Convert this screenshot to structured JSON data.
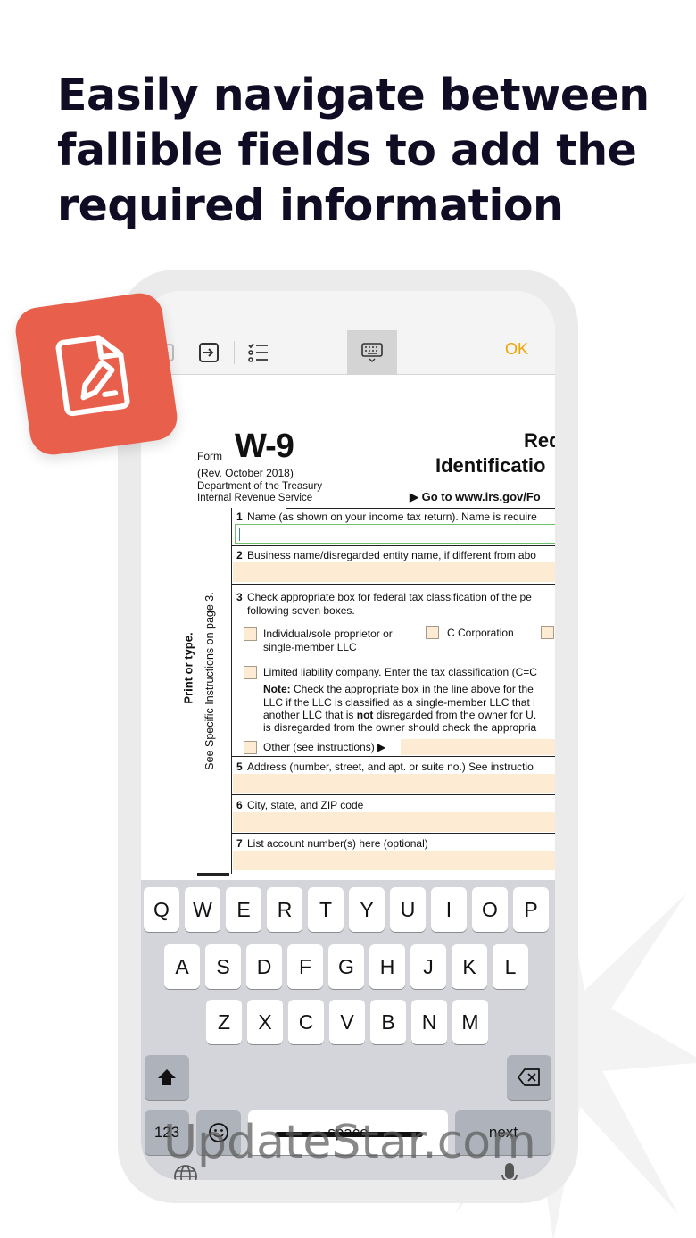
{
  "headline": {
    "line1": "Easily navigate between",
    "line2": "fallible fields to add the",
    "line3": "required information"
  },
  "toolbar": {
    "icons": [
      "back-arrow-icon",
      "next-field-icon",
      "checklist-icon",
      "keyboard-icon"
    ],
    "ok_label": "OK"
  },
  "form": {
    "form_label": "Form",
    "form_number": "W-9",
    "revision": "(Rev. October 2018)",
    "department": "Department of the Treasury",
    "irs": "Internal Revenue Service",
    "title_line1": "Red",
    "title_line2": "Identificatio",
    "goto_text": "▶ Go to www.irs.gov/Fo",
    "side_label_1": "Print or type.",
    "side_label_2": "See Specific Instructions on page 3.",
    "line1_num": "1",
    "line1_label": "Name (as shown on your income tax return). Name is require",
    "line2_num": "2",
    "line2_label": "Business name/disregarded entity name, if different from abo",
    "line3_num": "3",
    "line3_label": "Check appropriate box for federal tax classification of the pe",
    "line3_label_b": "following seven boxes.",
    "cb_individual_1": "Individual/sole proprietor or",
    "cb_individual_2": "single-member LLC",
    "cb_ccorp": "C Corporation",
    "cb_llc": "Limited liability company. Enter the tax classification (C=C",
    "note_1_bold": "Note:",
    "note_1": "Check the appropriate box in the line above for the",
    "note_2": "LLC if the LLC is classified as a single-member LLC that i",
    "note_3_a": "another LLC that is",
    "note_3_bold": "not",
    "note_3_b": "disregarded from the owner for U.",
    "note_4": "is disregarded from the owner should check the appropria",
    "cb_other": "Other (see instructions) ▶",
    "line5_num": "5",
    "line5_label": "Address (number, street, and apt. or suite no.) See instructio",
    "line6_num": "6",
    "line6_label": "City, state, and ZIP code",
    "line7_num": "7",
    "line7_label": "List account number(s) here (optional)"
  },
  "keyboard": {
    "row1": [
      "Q",
      "W",
      "E",
      "R",
      "T",
      "Y",
      "U",
      "I",
      "O",
      "P"
    ],
    "row2": [
      "A",
      "S",
      "D",
      "F",
      "G",
      "H",
      "J",
      "K",
      "L"
    ],
    "row3": [
      "Z",
      "X",
      "C",
      "V",
      "B",
      "N",
      "M"
    ],
    "numbers_label": "123",
    "space_label": "space",
    "next_label": "next"
  },
  "watermark": "UpdateStar.com",
  "colors": {
    "headline": "#100c24",
    "app_icon": "#e8604c",
    "ok": "#f0a400",
    "field_fill": "#fdebd3"
  }
}
